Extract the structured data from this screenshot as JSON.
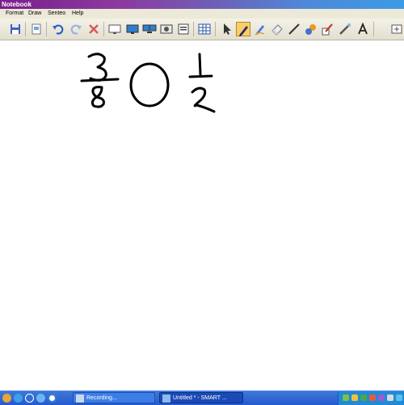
{
  "window": {
    "title": "Notebook"
  },
  "menu": [
    "Format",
    "Draw",
    "Senteo",
    "Help"
  ],
  "toolbar": {
    "icons": [
      "save-icon",
      "import-icon",
      "undo-icon",
      "redo-icon",
      "delete-icon",
      "screen-shade-icon",
      "full-screen-icon",
      "dual-display-icon",
      "capture-icon",
      "document-camera-icon",
      "table-icon",
      "select-icon",
      "pen-icon",
      "creative-pen-icon",
      "eraser-icon",
      "line-icon",
      "fill-icon",
      "magic-pen-icon",
      "shapes-icon",
      "text-icon"
    ],
    "active_tool": "pen-icon"
  },
  "taskbar": {
    "tasks": [
      {
        "label": "Recording...",
        "active": false
      },
      {
        "label": "Untitled * - SMART ...",
        "active": true
      }
    ]
  },
  "colors": {
    "accent": "#245ad0",
    "active_tool": "#f6cf6a"
  }
}
